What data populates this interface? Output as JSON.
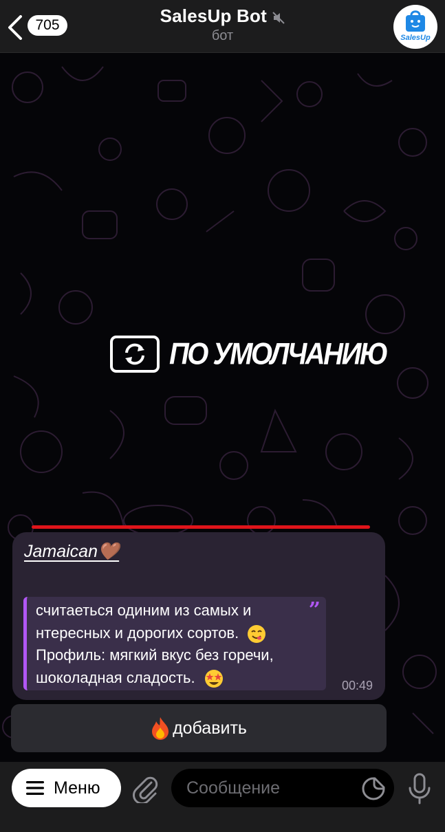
{
  "header": {
    "back_count": "705",
    "title": "SalesUp Bot",
    "subtitle": "бот",
    "avatar_label": "SalesUp"
  },
  "banner": {
    "text": "ПО УМОЛЧАНИЮ"
  },
  "message": {
    "title": "Jamaican🤎",
    "quote_lines": [
      "считаеться одиним из самых и",
      "нтересных и дорогих сортов.",
      "Профиль: мягкий вкус без горечи,",
      "шоколадная сладость."
    ],
    "time": "00:49"
  },
  "keyboard": {
    "button_label": "добавить"
  },
  "input_bar": {
    "menu_label": "Меню",
    "placeholder": "Сообщение"
  },
  "colors": {
    "accent": "#b157f5",
    "bubble": "#2a2333",
    "quote_bg": "#3a2f4a",
    "red_line": "#e0141a",
    "header_bg": "#1c1c1d"
  },
  "icons": [
    "chevron-left-icon",
    "mute-icon",
    "shopping-bag-icon",
    "refresh-icon",
    "quote-icon",
    "yum-emoji",
    "star-struck-emoji",
    "fire-icon",
    "hamburger-icon",
    "paperclip-icon",
    "sticker-icon",
    "microphone-icon"
  ]
}
